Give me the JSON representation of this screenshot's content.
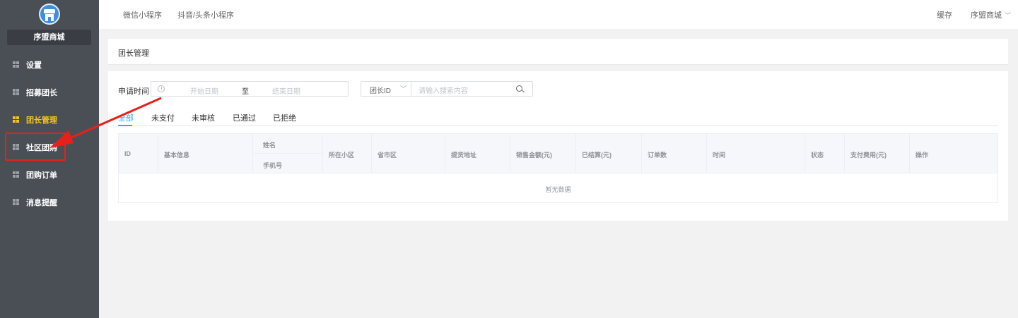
{
  "sidebar": {
    "shop_name": "序盟商城",
    "items": [
      {
        "label": "设置",
        "active": false
      },
      {
        "label": "招募团长",
        "active": false
      },
      {
        "label": "团长管理",
        "active": true
      },
      {
        "label": "社区团购",
        "active": false
      },
      {
        "label": "团购订单",
        "active": false
      },
      {
        "label": "消息提醒",
        "active": false
      }
    ]
  },
  "topbar": {
    "tabs": [
      "微信小程序",
      "抖音/头条小程序"
    ],
    "cache_label": "缓存",
    "account_label": "序盟商城"
  },
  "page": {
    "title": "团长管理"
  },
  "filters": {
    "apply_time_label": "申请时间",
    "start_placeholder": "开始日期",
    "range_separator": "至",
    "end_placeholder": "结束日期",
    "search_select_value": "团长ID",
    "search_placeholder": "请输入搜索内容"
  },
  "tabs": [
    "全部",
    "未支付",
    "未审核",
    "已通过",
    "已拒绝"
  ],
  "table": {
    "columns": [
      "ID",
      "基本信息",
      "姓名",
      "手机号",
      "所在小区",
      "省市区",
      "提货地址",
      "销售金额(元)",
      "已结算(元)",
      "订单数",
      "时间",
      "状态",
      "支付费用(元)",
      "操作"
    ],
    "empty_text": "暂无数据"
  },
  "colors": {
    "sidebar_bg": "#4a4f56",
    "active_menu": "#f5c518",
    "accent": "#409eff",
    "annotation": "#e8201b"
  }
}
